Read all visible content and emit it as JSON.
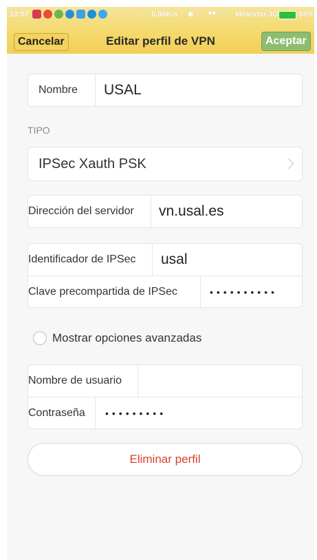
{
  "status_bar": {
    "time": "10:57",
    "overflow": "...",
    "net_speed": "0,08K/s",
    "carrier": "Movistar 3G",
    "battery": "93%",
    "notification_colors": [
      "#d23c4e",
      "#e84c3d",
      "#6bb84a",
      "#2b8fd8",
      "#3ea0e6",
      "#1f8fd6",
      "#3ba6f2"
    ]
  },
  "nav": {
    "cancel_label": "Cancelar",
    "title": "Editar perfil de VPN",
    "accept_label": "Aceptar"
  },
  "form": {
    "name": {
      "label": "Nombre",
      "value": "USAL"
    },
    "type_section": "TIPO",
    "type_value": "IPSec Xauth PSK",
    "server": {
      "label": "Dirección del servidor",
      "value": "vn.usal.es"
    },
    "ipsec_id": {
      "label": "Identificador de IPSec",
      "value": "usal"
    },
    "psk": {
      "label": "Clave precompartida de IPSec",
      "value": "••••••••••"
    },
    "advanced_label": "Mostrar opciones avanzadas",
    "username": {
      "label": "Nombre de usuario",
      "value": ""
    },
    "password": {
      "label": "Contraseña",
      "value": "•••••••••"
    }
  },
  "delete_label": "Eliminar perfil",
  "colors": {
    "nav_gradient": "#f4d96c",
    "accept_bg": "#8ebd72",
    "delete_text": "#d9402a",
    "background": "#f7f7f7"
  }
}
